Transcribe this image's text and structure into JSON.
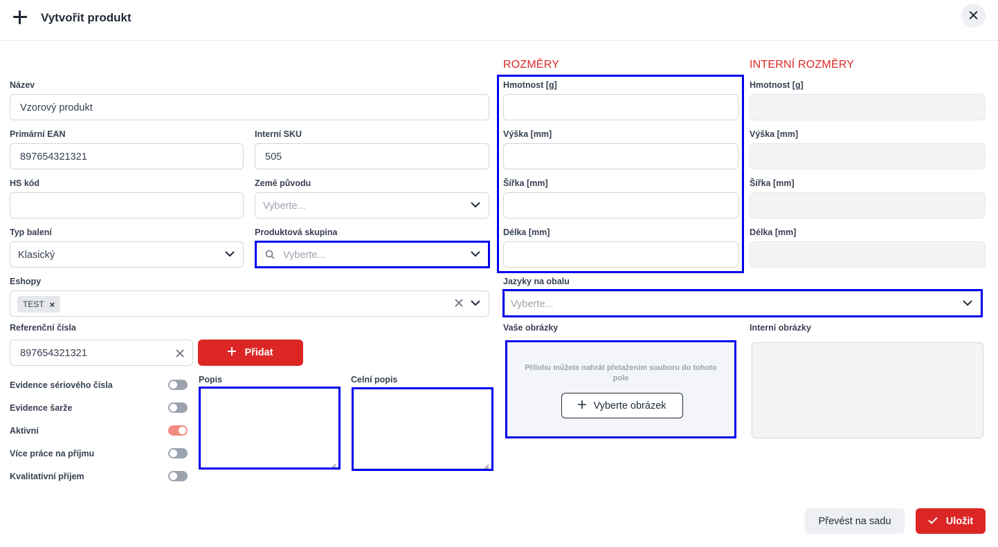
{
  "header": {
    "title": "Vytvořit produkt"
  },
  "form": {
    "name": {
      "label": "Název",
      "value": "Vzorový produkt"
    },
    "ean": {
      "label": "Primární EAN",
      "value": "897654321321"
    },
    "sku": {
      "label": "Interní SKU",
      "value": "505"
    },
    "hs": {
      "label": "HS kód",
      "value": ""
    },
    "country": {
      "label": "Země původu",
      "placeholder": "Vyberte..."
    },
    "packaging": {
      "label": "Typ balení",
      "value": "Klasický"
    },
    "group": {
      "label": "Produktová skupina",
      "placeholder": "Vyberte..."
    },
    "eshops": {
      "label": "Eshopy",
      "tags": [
        "TEST"
      ]
    },
    "refs": {
      "label": "Referenční čísla",
      "value": "897654321321",
      "add_label": "Přidat"
    },
    "toggles": [
      {
        "label": "Evidence sériového čísla",
        "on": false
      },
      {
        "label": "Evidence šarže",
        "on": false
      },
      {
        "label": "Aktivní",
        "on": true
      },
      {
        "label": "Více práce na příjmu",
        "on": false
      },
      {
        "label": "Kvalitativní příjem",
        "on": false
      }
    ],
    "description": {
      "label": "Popis"
    },
    "customs_description": {
      "label": "Celní popis"
    }
  },
  "dimensions": {
    "title": "ROZMĚRY",
    "weight": "Hmotnost [g]",
    "height": "Výška [mm]",
    "width": "Šířka [mm]",
    "length": "Délka [mm]"
  },
  "internal_dimensions": {
    "title": "INTERNÍ ROZMĚRY",
    "weight": "Hmotnost [g]",
    "height": "Výška [mm]",
    "width": "Šířka [mm]",
    "length": "Délka [mm]"
  },
  "languages": {
    "label": "Jazyky na obalu",
    "placeholder": "Vyberte..."
  },
  "images": {
    "label": "Vaše obrázky",
    "hint": "Přílohu můžete nahrát přetažením souboru do tohoto pole",
    "button": "Vyberte obrázek",
    "internal_label": "Interní obrázky"
  },
  "footer": {
    "convert_label": "Převést na sadu",
    "save_label": "Uložit"
  },
  "colors": {
    "accent": "#dc2626",
    "highlight": "#0000ee"
  }
}
